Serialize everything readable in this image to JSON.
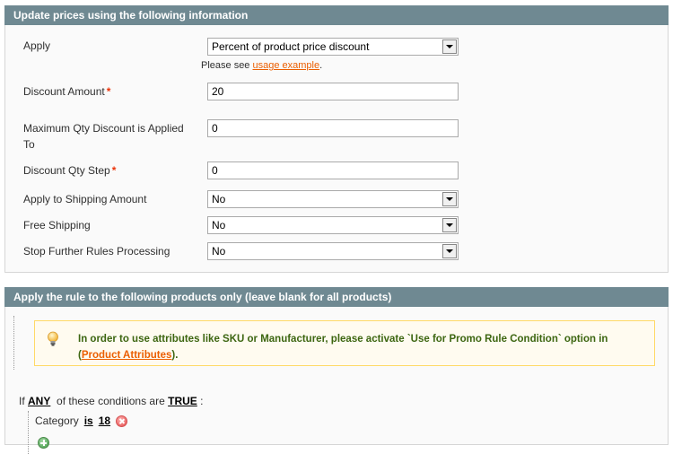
{
  "section1": {
    "title": "Update prices using the following information",
    "fields": [
      {
        "label": "Apply",
        "value": "Percent of product price discount",
        "type": "select",
        "required": false
      },
      {
        "label": "Discount Amount",
        "value": "20",
        "type": "text",
        "required": true
      },
      {
        "label": "Maximum Qty Discount is Applied To",
        "value": "0",
        "type": "text",
        "required": false
      },
      {
        "label": "Discount Qty Step",
        "value": "0",
        "type": "text",
        "required": true
      },
      {
        "label": "Apply to Shipping Amount",
        "value": "No",
        "type": "select",
        "required": false
      },
      {
        "label": "Free Shipping",
        "value": "No",
        "type": "select",
        "required": false
      },
      {
        "label": "Stop Further Rules Processing",
        "value": "No",
        "type": "select",
        "required": false
      }
    ],
    "note_prefix": "Please see ",
    "note_link": "usage example",
    "note_suffix": ".",
    "required_mark": "*"
  },
  "section2": {
    "title": "Apply the rule to the following products only (leave blank for all products)",
    "notice_text": "In order to use attributes like SKU or Manufacturer, please activate `Use for Promo Rule Condition` option in",
    "notice_link_open": "(",
    "notice_link": "Product Attributes",
    "notice_link_close": ").",
    "condition": {
      "prefix": "If",
      "aggregator": "ANY",
      "middle": "of these conditions are",
      "value": "TRUE",
      "suffix": ":"
    },
    "items": [
      {
        "attribute": "Category",
        "operator": "is",
        "value": "18"
      }
    ]
  },
  "colors": {
    "header_bg": "#6f8992",
    "link": "#eb5e00",
    "notice_text": "#3d6611",
    "required": "#eb340a"
  }
}
